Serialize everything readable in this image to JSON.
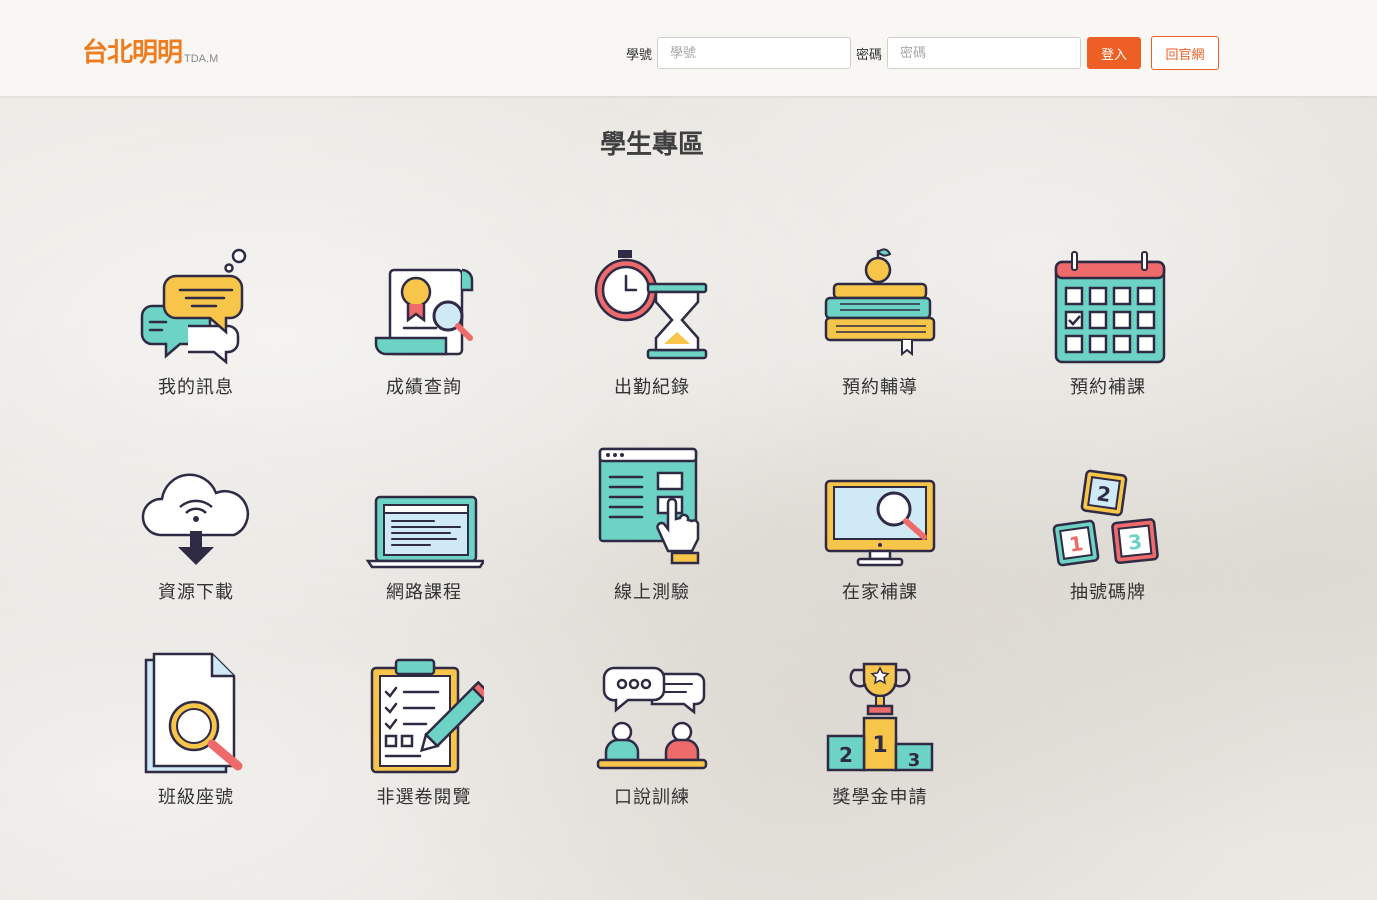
{
  "header": {
    "logo_main": "台北明明",
    "logo_sub": "TDA.M",
    "student_id_label": "學號",
    "student_id_placeholder": "學號",
    "password_label": "密碼",
    "password_placeholder": "密碼",
    "login_button": "登入",
    "home_button": "回官網"
  },
  "page_title": "學生專區",
  "tiles": [
    {
      "label": "我的訊息",
      "icon": "chat-bubbles-icon"
    },
    {
      "label": "成績查詢",
      "icon": "certificate-search-icon"
    },
    {
      "label": "出勤紀錄",
      "icon": "stopwatch-hourglass-icon"
    },
    {
      "label": "預約輔導",
      "icon": "books-apple-icon"
    },
    {
      "label": "預約補課",
      "icon": "calendar-icon"
    },
    {
      "label": "資源下載",
      "icon": "cloud-download-icon"
    },
    {
      "label": "網路課程",
      "icon": "laptop-icon"
    },
    {
      "label": "線上測驗",
      "icon": "online-test-window-icon"
    },
    {
      "label": "在家補課",
      "icon": "monitor-search-icon"
    },
    {
      "label": "抽號碼牌",
      "icon": "number-blocks-icon"
    },
    {
      "label": "班級座號",
      "icon": "document-search-icon"
    },
    {
      "label": "非選卷閱覽",
      "icon": "clipboard-pencil-icon"
    },
    {
      "label": "口說訓練",
      "icon": "conversation-icon"
    },
    {
      "label": "獎學金申請",
      "icon": "trophy-podium-icon"
    }
  ],
  "colors": {
    "accent": "#ee5f25",
    "logo": "#ee7d21",
    "outline": "#2f2b45",
    "teal": "#6dd3c5",
    "yellow": "#f6c54a",
    "red": "#ef6b6b",
    "blue": "#9fd6ea"
  }
}
